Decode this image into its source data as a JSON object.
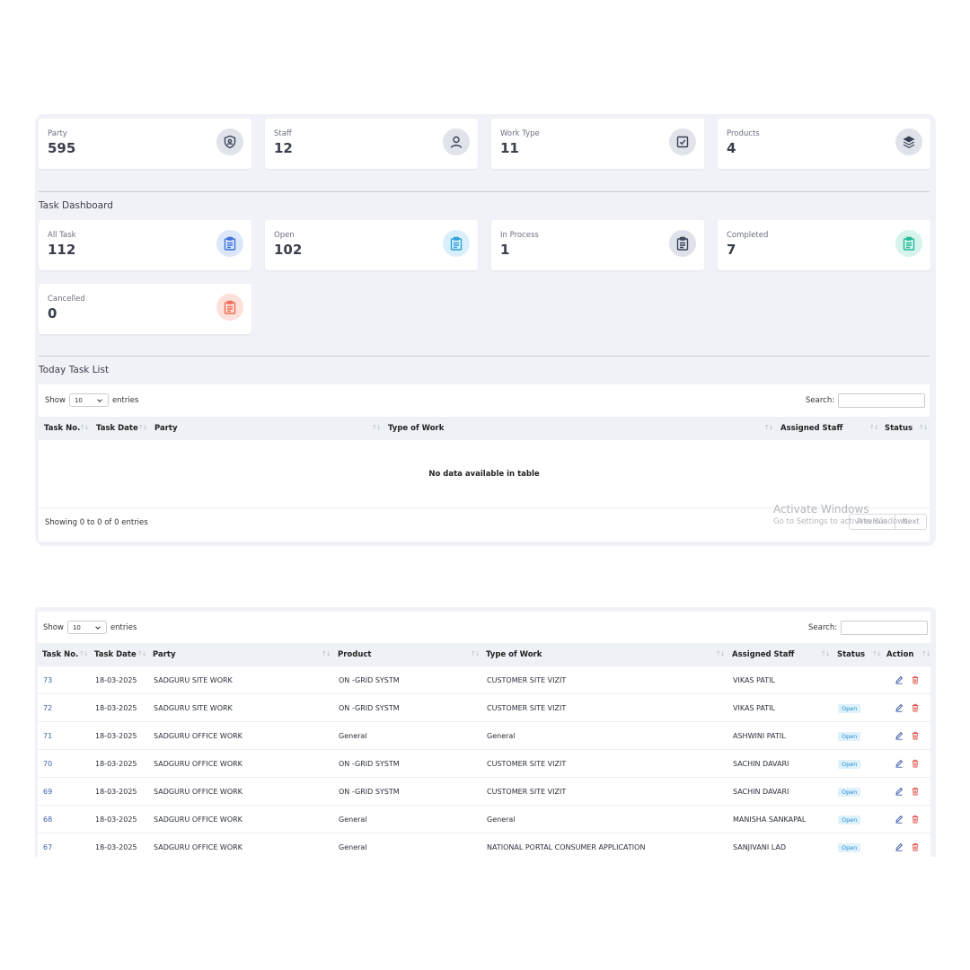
{
  "stats": [
    {
      "label": "Party",
      "value": "595",
      "icon": "shield-user-icon"
    },
    {
      "label": "Staff",
      "value": "12",
      "icon": "user-icon"
    },
    {
      "label": "Work Type",
      "value": "11",
      "icon": "check-square-icon"
    },
    {
      "label": "Products",
      "value": "4",
      "icon": "layers-icon"
    }
  ],
  "task_dashboard": {
    "title": "Task Dashboard",
    "cards": [
      {
        "label": "All Task",
        "value": "112",
        "color": "#3a6fd8",
        "bg": "#dde7fb"
      },
      {
        "label": "Open",
        "value": "102",
        "color": "#2aa0d8",
        "bg": "#d9f0fb"
      },
      {
        "label": "In Process",
        "value": "1",
        "color": "#3a4257",
        "bg": "#dfe2ea"
      },
      {
        "label": "Completed",
        "value": "7",
        "color": "#20b795",
        "bg": "#d6f4ec"
      },
      {
        "label": "Cancelled",
        "value": "0",
        "color": "#ee6a55",
        "bg": "#fde0da"
      }
    ]
  },
  "today_list": {
    "title": "Today Task List",
    "show_label": "Show",
    "entries_value": "10",
    "entries_label": "entries",
    "search_label": "Search:",
    "columns": [
      "Task No.",
      "Task Date",
      "Party",
      "Type of Work",
      "Assigned Staff",
      "Status"
    ],
    "empty_text": "No data available in table",
    "showing_text": "Showing 0 to 0 of 0 entries",
    "prev_label": "Previous",
    "next_label": "Next"
  },
  "watermark": {
    "line1": "Activate Windows",
    "line2": "Go to Settings to activate Windows."
  },
  "task_table": {
    "show_label": "Show",
    "entries_value": "10",
    "entries_label": "entries",
    "search_label": "Search:",
    "columns": [
      "Task No.",
      "Task Date",
      "Party",
      "Product",
      "Type of Work",
      "Assigned Staff",
      "Status",
      "Action"
    ],
    "rows": [
      {
        "no": "73",
        "date": "18-03-2025",
        "party": "SADGURU SITE WORK",
        "product": "ON -GRID SYSTM",
        "work": "CUSTOMER SITE VIZIT",
        "staff": "VIKAS PATIL",
        "status": ""
      },
      {
        "no": "72",
        "date": "18-03-2025",
        "party": "SADGURU SITE WORK",
        "product": "ON -GRID SYSTM",
        "work": "CUSTOMER SITE VIZIT",
        "staff": "VIKAS PATIL",
        "status": "Open"
      },
      {
        "no": "71",
        "date": "18-03-2025",
        "party": "SADGURU OFFICE WORK",
        "product": "General",
        "work": "General",
        "staff": "ASHWINI PATIL",
        "status": "Open"
      },
      {
        "no": "70",
        "date": "18-03-2025",
        "party": "SADGURU OFFICE WORK",
        "product": "ON -GRID SYSTM",
        "work": "CUSTOMER SITE VIZIT",
        "staff": "SACHIN DAVARI",
        "status": "Open"
      },
      {
        "no": "69",
        "date": "18-03-2025",
        "party": "SADGURU OFFICE WORK",
        "product": "ON -GRID SYSTM",
        "work": "CUSTOMER SITE VIZIT",
        "staff": "SACHIN DAVARI",
        "status": "Open"
      },
      {
        "no": "68",
        "date": "18-03-2025",
        "party": "SADGURU OFFICE WORK",
        "product": "General",
        "work": "General",
        "staff": "MANISHA SANKAPAL",
        "status": "Open"
      },
      {
        "no": "67",
        "date": "18-03-2025",
        "party": "SADGURU OFFICE WORK",
        "product": "General",
        "work": "NATIONAL PORTAL CONSUMER APPLICATION",
        "staff": "SANJIVANI LAD",
        "status": "Open"
      }
    ]
  },
  "colors": {
    "badge_bg": "#dff1fb",
    "badge_text": "#2a8fd0",
    "edit": "#3d5fa8",
    "delete": "#e0524a"
  }
}
